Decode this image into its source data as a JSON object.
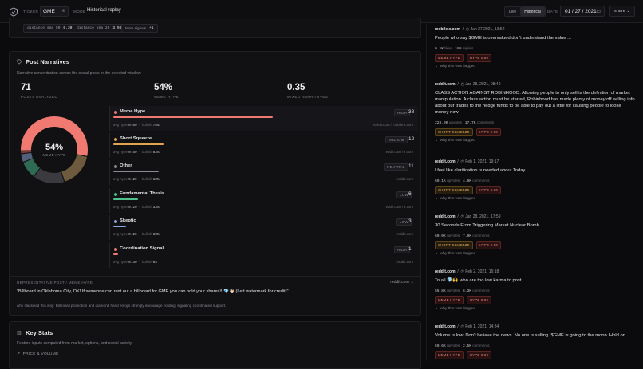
{
  "topbar": {
    "ticker_label": "TICKER",
    "ticker_value": "GME",
    "mode_label": "MODE",
    "mode_value": "Historical replay",
    "seg_live": "Live",
    "seg_historical": "Historical",
    "date_label": "DATE",
    "date_value": "01 / 27 / 2021",
    "share_label": "share"
  },
  "dist": {
    "chips": [
      {
        "label": "distance sma 50",
        "value": "0.30"
      },
      {
        "label": "distance sma 20",
        "value": "3.98"
      },
      {
        "label": "More signals",
        "value": "+1"
      }
    ]
  },
  "narratives": {
    "title": "Post Narratives",
    "subtitle": "Narrative concentration across the social posts in the selected window.",
    "stats": [
      {
        "value": "71",
        "label": "POSTS ANALYZED"
      },
      {
        "value": "54%",
        "label": "MEME HYPE"
      },
      {
        "value": "0.35",
        "label": "MIXED NARRATIVES"
      }
    ],
    "donut_value": "54%",
    "donut_label": "MEME HYPE",
    "rows": [
      {
        "name": "Meme Hype",
        "level": "HIGH",
        "count": "38",
        "fraction": 0.54,
        "avg_hype": "0.60",
        "bullish": "78%",
        "source": "reddit.com / mobile.x.com",
        "color": "#f07a72"
      },
      {
        "name": "Short Squeeze",
        "level": "MEDIUM",
        "count": "12",
        "fraction": 0.17,
        "avg_hype": "0.50",
        "bullish": "83%",
        "source": "reddit.com / x.com",
        "color": "#e3a44f"
      },
      {
        "name": "Other",
        "level": "NEUTRAL",
        "count": "11",
        "fraction": 0.155,
        "avg_hype": "0.20",
        "bullish": "18%",
        "source": "reddit.com",
        "color": "#8a8a92"
      },
      {
        "name": "Fundamental Thesis",
        "level": "LOW",
        "count": "6",
        "fraction": 0.085,
        "avg_hype": "0.20",
        "bullish": "33%",
        "source": "reddit.com / x.com",
        "color": "#4fbf8c"
      },
      {
        "name": "Skeptic",
        "level": "LOW",
        "count": "3",
        "fraction": 0.042,
        "avg_hype": "0.20",
        "bullish": "33%",
        "source": "reddit.com",
        "color": "#8aa6e0"
      },
      {
        "name": "Coordination Signal",
        "level": "HIGH",
        "count": "1",
        "fraction": 0.014,
        "avg_hype": "0.30",
        "bullish": "0%",
        "source": "reddit.com",
        "color": "#f07a72"
      }
    ],
    "meta_avg_hype": "avg hype",
    "meta_bullish": "bullish",
    "rep_label": "REPRESENTATIVE POST / MEME HYPE",
    "rep_link": "reddit.com →",
    "rep_text": "\"Billboard in Oklahoma City, OK! If someone can rent out a billboard for GME you can hold your shares!! 💎👋🏻 (Left watermark for credit)\"",
    "rep_why": "why classified this way: Billboard promotion and diamond hand emojis strongly encourage holding, signaling coordinated support."
  },
  "keystats": {
    "title": "Key Stats",
    "subtitle": "Feature inputs computed from market, options, and social activity.",
    "section": "PRICE & VOLUME"
  },
  "feed": {
    "posts": [
      {
        "source": "mobile.x.com",
        "time": "Jan 27,2021, 13:52",
        "text": "People who say $GME is overvalued don't understand the value ...",
        "s1": "0.1K",
        "s1l": "likes",
        "s2": "105",
        "s2l": "replies",
        "tags": [
          "MEME HYPE",
          "HYPE 0.80"
        ],
        "why": "why this was flagged"
      },
      {
        "source": "reddit.com",
        "time": "Jan 28, 2021, 08:49",
        "text": "CLASS ACTION AGAINST ROBINHOOD. Allowing people to only sell is the definition of market manipulation. A class action must be started, Robinhood has made plenty of money off selling info about our trades to the hedge funds to be able to pay out a little for causing people to loose money now",
        "s1": "228.0K",
        "s1l": "upvotes",
        "s2": "17.7K",
        "s2l": "comments",
        "tags": [
          "SHORT SQUEEZE",
          "HYPE 0.80"
        ],
        "why": "why this was flagged"
      },
      {
        "source": "reddit.com",
        "time": "Feb 1, 2021, 19:17",
        "text": "I feel like clarification is needed about Today",
        "s1": "60.1K",
        "s1l": "upvotes",
        "s2": "4.9K",
        "s2l": "comments",
        "tags": [
          "SHORT SQUEEZE",
          "HYPE 0.80"
        ],
        "why": "why this was flagged"
      },
      {
        "source": "reddit.com",
        "time": "Jan 28, 2021, 17:59",
        "text": "30 Seconds From Triggering Market Nuclear Bomb",
        "s1": "60.0K",
        "s1l": "upvotes",
        "s2": "7.9K",
        "s2l": "comments",
        "tags": [
          "SHORT SQUEEZE",
          "HYPE 0.80"
        ],
        "why": "why this was flagged"
      },
      {
        "source": "reddit.com",
        "time": "Feb 2, 2021, 16:18",
        "text": "To all 💎🙌 who are too low karma to post",
        "s1": "55.8K",
        "s1l": "upvotes",
        "s2": "6.3K",
        "s2l": "comments",
        "tags": [
          "MEME HYPE",
          "HYPE 0.80"
        ],
        "why": "why this was flagged"
      },
      {
        "source": "reddit.com",
        "time": "Feb 1, 2021, 14:34",
        "text": "Volume is low. Don't believe the news. No one is selling. $GME is going to the moon. Hold on.",
        "s1": "50.6K",
        "s1l": "upvotes",
        "s2": "2.5K",
        "s2l": "comments",
        "tags": [
          "MEME HYPE",
          "HYPE 0.80"
        ],
        "why": "why this was flagged"
      }
    ]
  }
}
